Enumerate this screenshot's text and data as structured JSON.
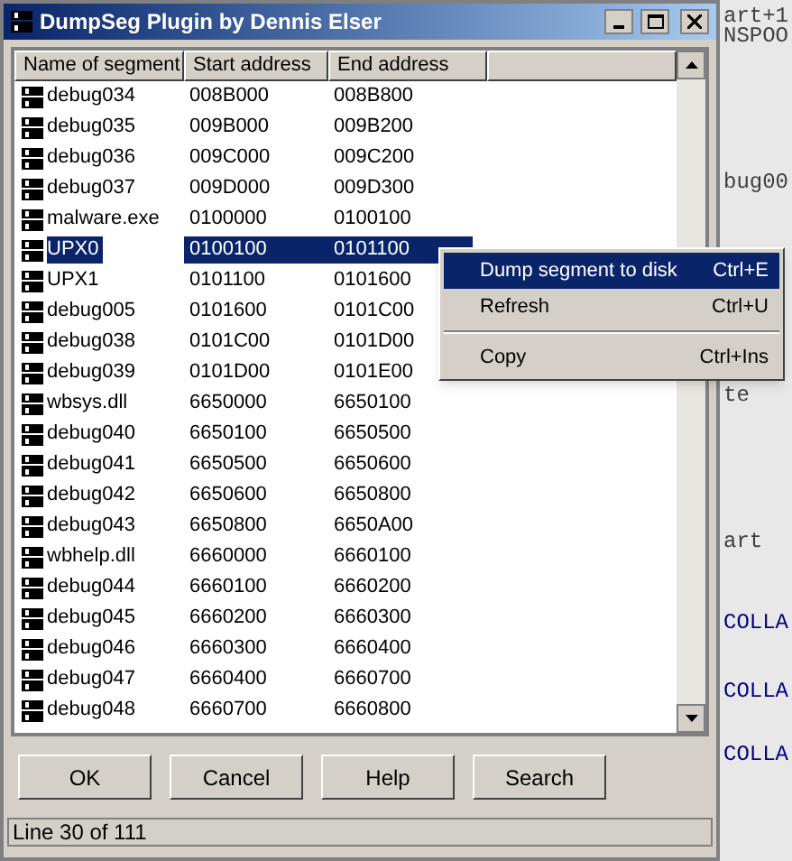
{
  "window": {
    "title": "DumpSeg Plugin by Dennis Elser"
  },
  "table": {
    "columns": [
      "Name of segment",
      "Start address",
      "End address"
    ],
    "rows": [
      {
        "name": "debug034",
        "start": "008B000",
        "end": "008B800",
        "selected": false
      },
      {
        "name": "debug035",
        "start": "009B000",
        "end": "009B200",
        "selected": false
      },
      {
        "name": "debug036",
        "start": "009C000",
        "end": "009C200",
        "selected": false
      },
      {
        "name": "debug037",
        "start": "009D000",
        "end": "009D300",
        "selected": false
      },
      {
        "name": "malware.exe",
        "start": "0100000",
        "end": "0100100",
        "selected": false
      },
      {
        "name": "UPX0",
        "start": "0100100",
        "end": "0101100",
        "selected": true
      },
      {
        "name": "UPX1",
        "start": "0101100",
        "end": "0101600",
        "selected": false
      },
      {
        "name": "debug005",
        "start": "0101600",
        "end": "0101C00",
        "selected": false
      },
      {
        "name": "debug038",
        "start": "0101C00",
        "end": "0101D00",
        "selected": false
      },
      {
        "name": "debug039",
        "start": "0101D00",
        "end": "0101E00",
        "selected": false
      },
      {
        "name": "wbsys.dll",
        "start": "6650000",
        "end": "6650100",
        "selected": false
      },
      {
        "name": "debug040",
        "start": "6650100",
        "end": "6650500",
        "selected": false
      },
      {
        "name": "debug041",
        "start": "6650500",
        "end": "6650600",
        "selected": false
      },
      {
        "name": "debug042",
        "start": "6650600",
        "end": "6650800",
        "selected": false
      },
      {
        "name": "debug043",
        "start": "6650800",
        "end": "6650A00",
        "selected": false
      },
      {
        "name": "wbhelp.dll",
        "start": "6660000",
        "end": "6660100",
        "selected": false
      },
      {
        "name": "debug044",
        "start": "6660100",
        "end": "6660200",
        "selected": false
      },
      {
        "name": "debug045",
        "start": "6660200",
        "end": "6660300",
        "selected": false
      },
      {
        "name": "debug046",
        "start": "6660300",
        "end": "6660400",
        "selected": false
      },
      {
        "name": "debug047",
        "start": "6660400",
        "end": "6660700",
        "selected": false
      },
      {
        "name": "debug048",
        "start": "6660700",
        "end": "6660800",
        "selected": false
      }
    ]
  },
  "buttons": [
    "OK",
    "Cancel",
    "Help",
    "Search"
  ],
  "status_bar": "Line 30 of 111",
  "context_menu": [
    {
      "kind": "item",
      "label": "Dump segment to disk",
      "shortcut": "Ctrl+E",
      "selected": true
    },
    {
      "kind": "item",
      "label": "Refresh",
      "shortcut": "Ctrl+U",
      "selected": false
    },
    {
      "kind": "separator"
    },
    {
      "kind": "item",
      "label": "Copy",
      "shortcut": "Ctrl+Ins",
      "selected": false
    }
  ],
  "background_listing": [
    {
      "text": "art+1",
      "kind": "plain"
    },
    {
      "text": "NSPOO",
      "kind": "plain"
    },
    {
      "text": "bug00",
      "kind": "plain"
    },
    {
      "text": "te",
      "kind": "plain"
    },
    {
      "text": "art",
      "kind": "plain"
    },
    {
      "text": "COLLA",
      "kind": "link"
    },
    {
      "text": "COLLA",
      "kind": "link"
    },
    {
      "text": "COLLA",
      "kind": "link"
    }
  ]
}
